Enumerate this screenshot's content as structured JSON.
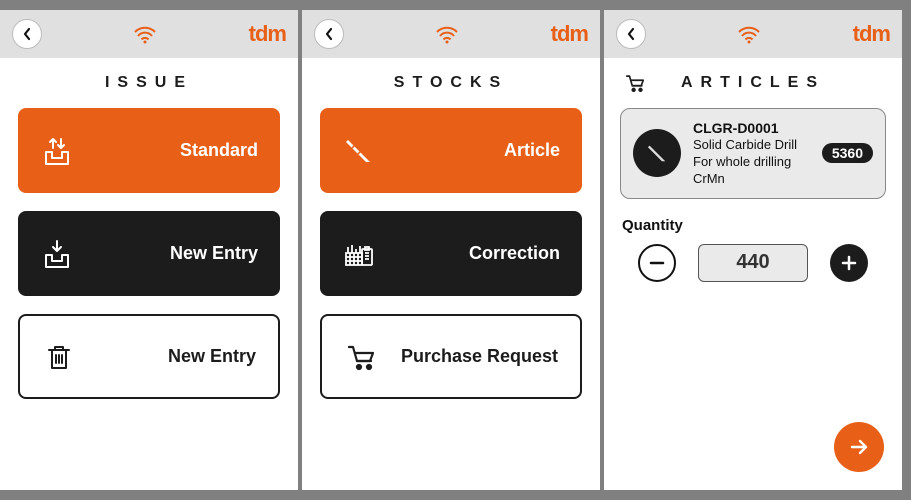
{
  "brand": "tdm",
  "screens": {
    "issue": {
      "title": "ISSUE",
      "tiles": {
        "standard": {
          "label": "Standard"
        },
        "new_entry": {
          "label": "New Entry"
        },
        "trash": {
          "label": "New Entry"
        }
      }
    },
    "stocks": {
      "title": "STOCKS",
      "tiles": {
        "article": {
          "label": "Article"
        },
        "correction": {
          "label": "Correction"
        },
        "purchase": {
          "label": "Purchase Request"
        }
      }
    },
    "articles": {
      "title": "ARTICLES",
      "item": {
        "id": "CLGR-D0001",
        "name": "Solid Carbide Drill",
        "desc": "For whole drilling CrMn",
        "badge": "5360"
      },
      "quantity_label": "Quantity",
      "quantity_value": "440"
    }
  }
}
